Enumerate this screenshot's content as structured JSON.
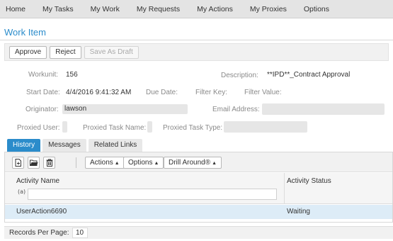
{
  "nav": [
    "Home",
    "My Tasks",
    "My Work",
    "My Requests",
    "My Actions",
    "My Proxies",
    "Options"
  ],
  "page_title": "Work Item",
  "actions": {
    "approve": "Approve",
    "reject": "Reject",
    "save_draft": "Save As Draft"
  },
  "fields": {
    "workunit_label": "Workunit:",
    "workunit_value": "156",
    "description_label": "Description:",
    "description_value": "**IPD**_Contract Approval",
    "start_date_label": "Start Date:",
    "start_date_value": "4/4/2016 9:41:32 AM",
    "due_date_label": "Due Date:",
    "filter_key_label": "Filter Key:",
    "filter_value_label": "Filter Value:",
    "originator_label": "Originator:",
    "originator_value": "lawson",
    "email_label": "Email Address:",
    "proxied_user_label": "Proxied User:",
    "proxied_task_name_label": "Proxied Task Name:",
    "proxied_task_type_label": "Proxied Task Type:"
  },
  "tabs": [
    "History",
    "Messages",
    "Related Links"
  ],
  "panel": {
    "actions_label": "Actions",
    "options_label": "Options",
    "drill_label": "Drill Around®",
    "columns": [
      "Activity Name",
      "Activity Status"
    ],
    "filter_icon_text": "(a)",
    "rows": [
      {
        "name": "UserAction6690",
        "status": "Waiting"
      }
    ]
  },
  "footer": {
    "records_label": "Records Per Page:",
    "records_value": "10"
  },
  "colors": {
    "accent": "#2b8ccb",
    "selected_row": "#ddecf7"
  }
}
